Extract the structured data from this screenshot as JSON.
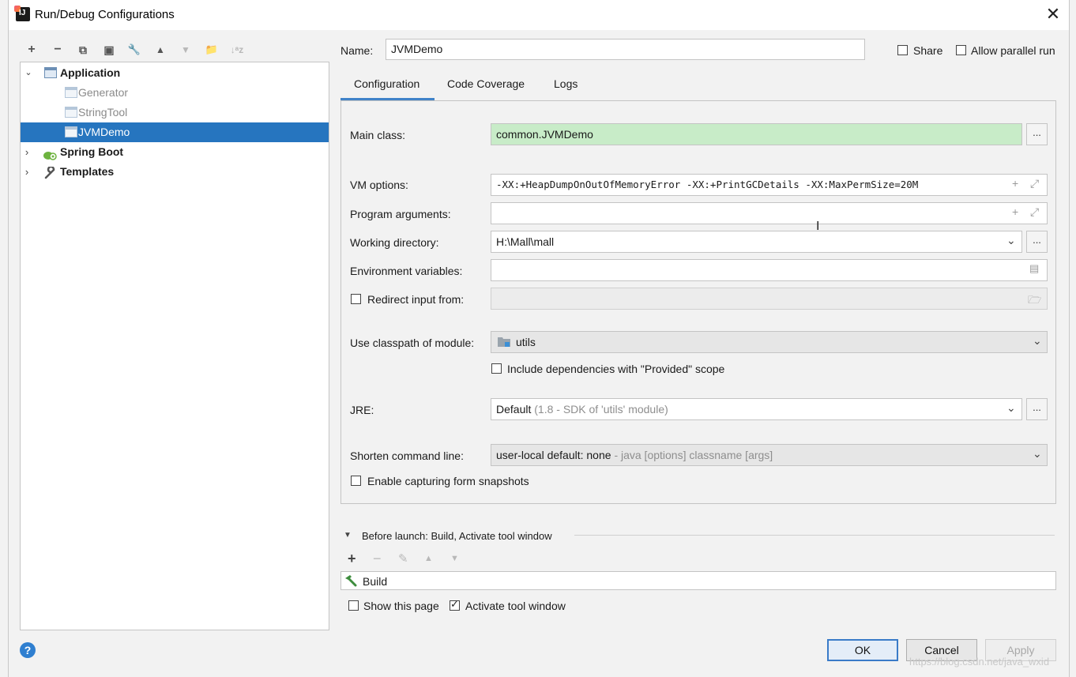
{
  "window": {
    "title": "Run/Debug Configurations",
    "close_glyph": "✕"
  },
  "toolbar": {
    "add": "+",
    "remove": "−",
    "copy": "⧉",
    "save": "▣",
    "edit_defaults": "🔧",
    "move_up": "▲",
    "move_down": "▼",
    "folder": "📁",
    "sort": "↓ᵃz"
  },
  "tree": {
    "application": "Application",
    "children": [
      "Generator",
      "StringTool",
      "JVMDemo"
    ],
    "spring_boot": "Spring Boot",
    "templates": "Templates"
  },
  "name": {
    "label": "Name:",
    "value": "JVMDemo"
  },
  "share_label": "Share",
  "allow_parallel_label": "Allow parallel run",
  "tabs": [
    "Configuration",
    "Code Coverage",
    "Logs"
  ],
  "form": {
    "main_class_label": "Main class:",
    "main_class_value": "common.JVMDemo",
    "vm_options_label": "VM options:",
    "vm_options_value": "-XX:+HeapDumpOnOutOfMemoryError -XX:+PrintGCDetails -XX:MaxPermSize=20M",
    "program_args_label": "Program arguments:",
    "program_args_value": "",
    "working_dir_label": "Working directory:",
    "working_dir_value": "H:\\Mall\\mall",
    "env_vars_label": "Environment variables:",
    "env_vars_value": "",
    "redirect_label": "Redirect input from:",
    "classpath_label": "Use classpath of module:",
    "classpath_value": "utils",
    "include_deps_label": "Include dependencies with \"Provided\" scope",
    "jre_label": "JRE:",
    "jre_value": "Default",
    "jre_hint": "(1.8 - SDK of 'utils' module)",
    "shorten_label": "Shorten command line:",
    "shorten_value": "user-local default: none",
    "shorten_hint": "- java [options] classname [args]",
    "capture_label": "Enable capturing form snapshots",
    "dots": "..."
  },
  "before_launch": {
    "title": "Before launch: Build, Activate tool window",
    "task": "Build",
    "show_page_label": "Show this page",
    "activate_label": "Activate tool window"
  },
  "buttons": {
    "ok": "OK",
    "cancel": "Cancel",
    "apply": "Apply",
    "help": "?"
  },
  "watermark": "https://blog.csdn.net/java_wxid"
}
